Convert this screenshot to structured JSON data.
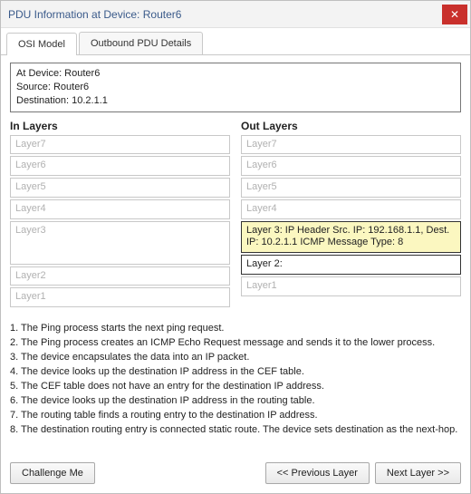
{
  "window": {
    "title": "PDU Information at Device: Router6",
    "close_icon": "✕"
  },
  "tabs": [
    {
      "label": "OSI Model",
      "active": true
    },
    {
      "label": "Outbound PDU Details",
      "active": false
    }
  ],
  "infobox": {
    "at_device": "At Device: Router6",
    "source": "Source: Router6",
    "destination": "Destination: 10.2.1.1"
  },
  "layers": {
    "in_heading": "In Layers",
    "out_heading": "Out Layers",
    "in": [
      {
        "id": 7,
        "label": "Layer7",
        "state": "inactive"
      },
      {
        "id": 6,
        "label": "Layer6",
        "state": "inactive"
      },
      {
        "id": 5,
        "label": "Layer5",
        "state": "inactive"
      },
      {
        "id": 4,
        "label": "Layer4",
        "state": "inactive"
      },
      {
        "id": 3,
        "label": "Layer3",
        "state": "inactive"
      },
      {
        "id": 2,
        "label": "Layer2",
        "state": "inactive"
      },
      {
        "id": 1,
        "label": "Layer1",
        "state": "inactive"
      }
    ],
    "out": [
      {
        "id": 7,
        "label": "Layer7",
        "state": "inactive"
      },
      {
        "id": 6,
        "label": "Layer6",
        "state": "inactive"
      },
      {
        "id": 5,
        "label": "Layer5",
        "state": "inactive"
      },
      {
        "id": 4,
        "label": "Layer4",
        "state": "inactive"
      },
      {
        "id": 3,
        "label": "Layer 3: IP Header Src. IP: 192.168.1.1, Dest. IP: 10.2.1.1 ICMP Message Type: 8",
        "state": "active-yellow"
      },
      {
        "id": 2,
        "label": "Layer 2:",
        "state": "active-outline"
      },
      {
        "id": 1,
        "label": "Layer1",
        "state": "inactive"
      }
    ]
  },
  "description_lines": [
    "1. The Ping process starts the next ping request.",
    "2. The Ping process creates an ICMP Echo Request message and sends it to the lower process.",
    "3. The device encapsulates the data into an IP packet.",
    "4. The device looks up the destination IP address in the CEF table.",
    "5. The CEF table does not have an entry for the destination IP address.",
    "6. The device looks up the destination IP address in the routing table.",
    "7. The routing table finds a routing entry to the destination IP address.",
    "8. The destination routing entry is connected static route. The device sets destination as the next-hop."
  ],
  "buttons": {
    "challenge": "Challenge Me",
    "prev": "<< Previous Layer",
    "next": "Next Layer >>"
  }
}
